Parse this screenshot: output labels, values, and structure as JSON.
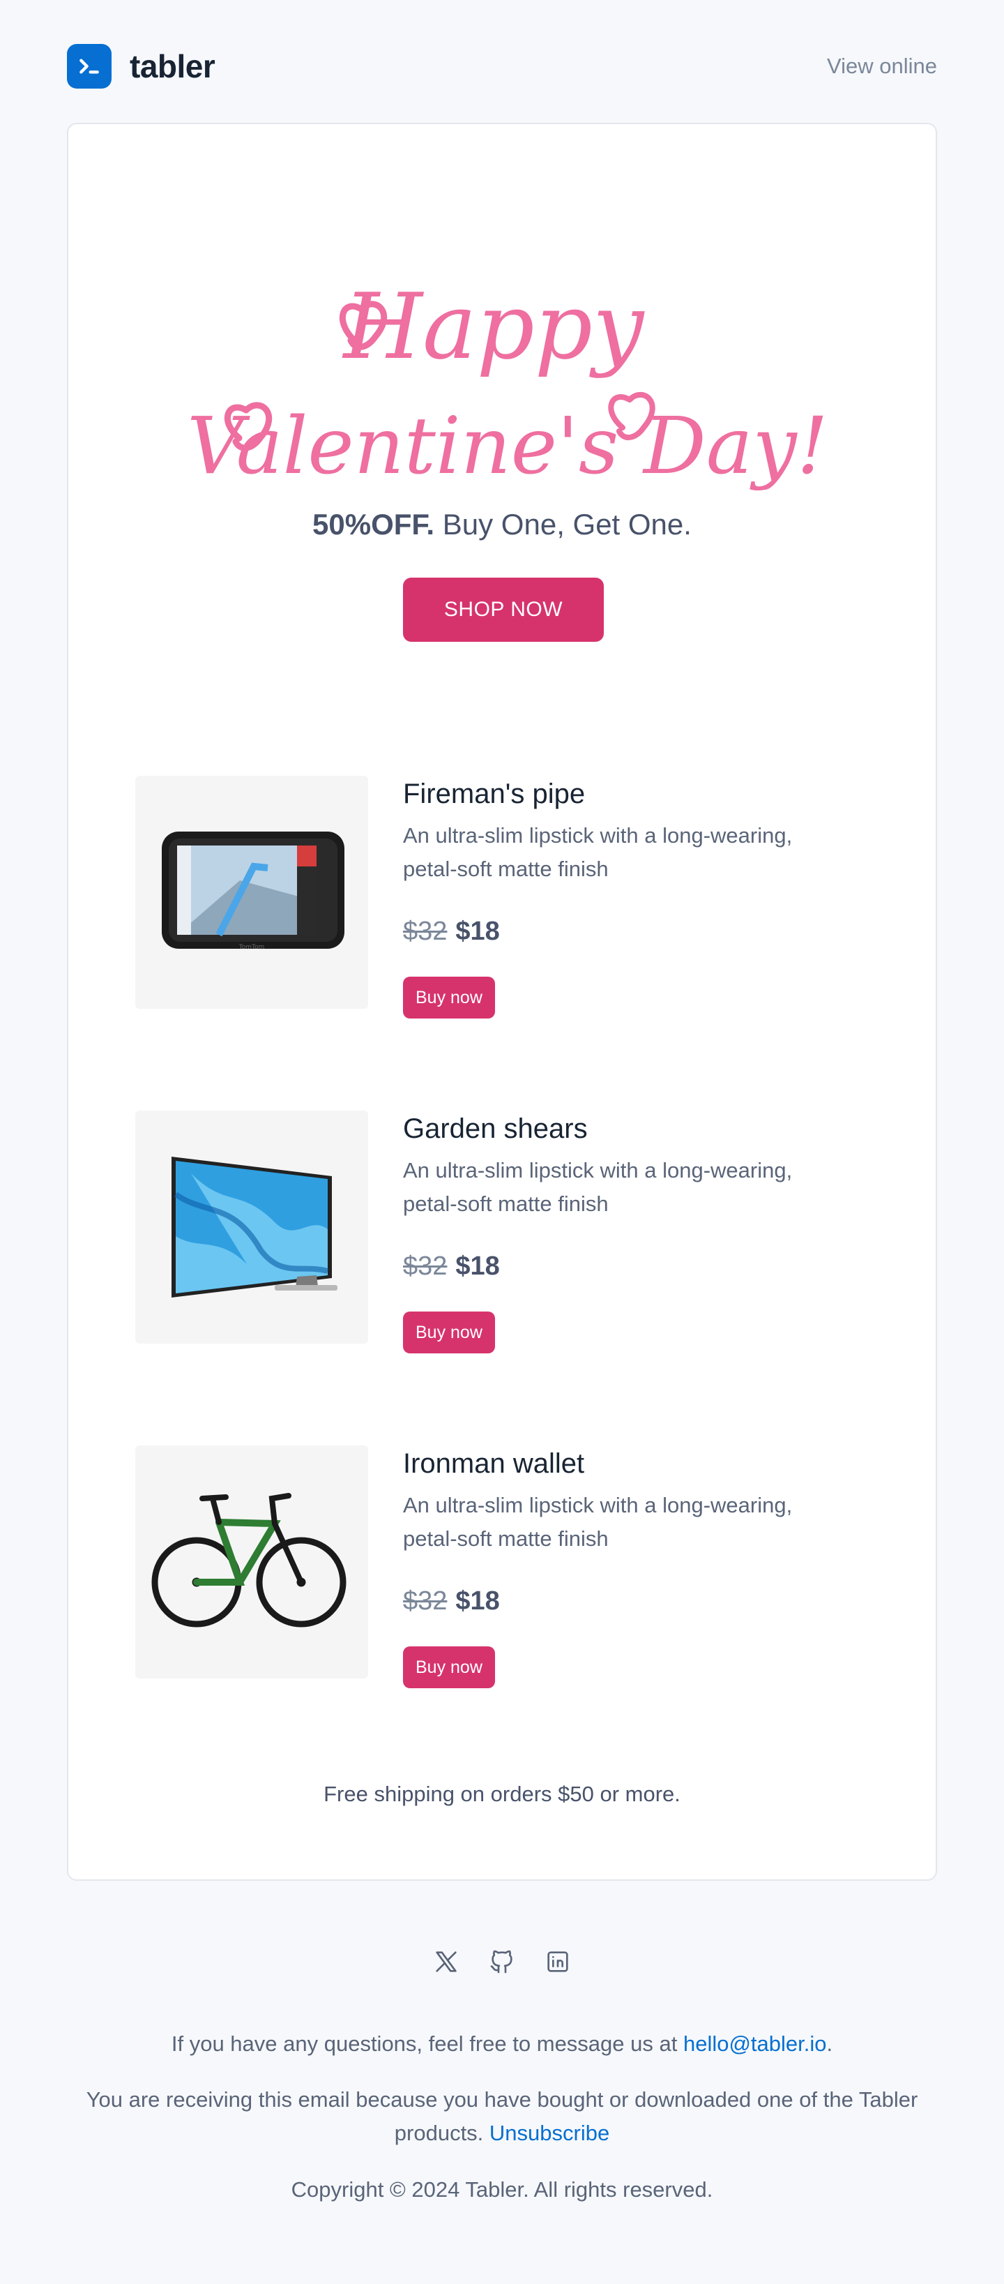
{
  "header": {
    "brand_name": "tabler",
    "view_online": "View online"
  },
  "hero": {
    "heading_line1": "Happy",
    "heading_line2": "Valentine's Day!",
    "offer_bold": "50%OFF.",
    "offer_rest": " Buy One, Get One.",
    "shop_button": "SHOP NOW",
    "accent_color": "#d6336c",
    "script_color": "#ee6fa0"
  },
  "products": [
    {
      "name": "Fireman's pipe",
      "description": "An ultra-slim lipstick with a long-wearing, petal-soft matte finish",
      "old_price": "$32",
      "new_price": "$18",
      "button": "Buy now",
      "image": "gps-navigator-image"
    },
    {
      "name": "Garden shears",
      "description": "An ultra-slim lipstick with a long-wearing, petal-soft matte finish",
      "old_price": "$32",
      "new_price": "$18",
      "button": "Buy now",
      "image": "television-image"
    },
    {
      "name": "Ironman wallet",
      "description": "An ultra-slim lipstick with a long-wearing, petal-soft matte finish",
      "old_price": "$32",
      "new_price": "$18",
      "button": "Buy now",
      "image": "bicycle-image"
    }
  ],
  "shipping_note": "Free shipping on orders $50 or more.",
  "footer": {
    "social_icons": [
      "x-icon",
      "github-icon",
      "linkedin-icon"
    ],
    "questions_text": "If you have any questions, feel free to message us at ",
    "email": "hello@tabler.io",
    "questions_end": ".",
    "receiving_text": "You are receiving this email because you have bought or downloaded one of the Tabler products. ",
    "unsubscribe": "Unsubscribe",
    "copyright": "Copyright © 2024 Tabler. All rights reserved."
  }
}
